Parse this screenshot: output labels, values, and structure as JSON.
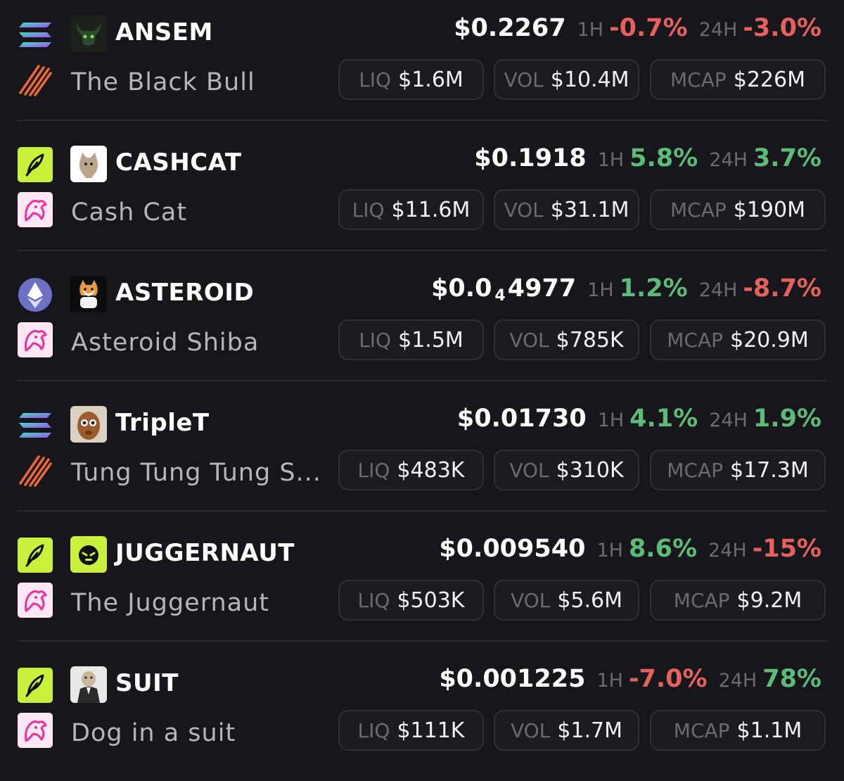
{
  "colors": {
    "background": "#17171b",
    "positive": "#5dbb7a",
    "negative": "#e6605e",
    "muted": "#6a6a72"
  },
  "labels": {
    "h1": "1H",
    "h24": "24H",
    "liq": "LIQ",
    "vol": "VOL",
    "mcap": "MCAP"
  },
  "tokens": [
    {
      "chain_icon": "solana-icon",
      "dex_icon": "dex-stripes-icon",
      "avatar": "bull-avatar",
      "symbol": "ANSEM",
      "name": "The Black Bull",
      "price": "$0.2267",
      "price_prefix": "",
      "price_subscript": "",
      "price_suffix": "",
      "change_1h": "-0.7%",
      "change_1h_dir": "neg",
      "change_24h": "-3.0%",
      "change_24h_dir": "neg",
      "liq": "$1.6M",
      "vol": "$10.4M",
      "mcap": "$226M"
    },
    {
      "chain_icon": "feather-chain-icon",
      "dex_icon": "uniswap-icon",
      "avatar": "cat-avatar",
      "symbol": "CASHCAT",
      "name": "Cash Cat",
      "price": "$0.1918",
      "price_prefix": "",
      "price_subscript": "",
      "price_suffix": "",
      "change_1h": "5.8%",
      "change_1h_dir": "pos",
      "change_24h": "3.7%",
      "change_24h_dir": "pos",
      "liq": "$11.6M",
      "vol": "$31.1M",
      "mcap": "$190M"
    },
    {
      "chain_icon": "ethereum-icon",
      "dex_icon": "uniswap-icon",
      "avatar": "shiba-avatar",
      "symbol": "ASTEROID",
      "name": "Asteroid Shiba",
      "price": "",
      "price_prefix": "$0.0",
      "price_subscript": "4",
      "price_suffix": "4977",
      "change_1h": "1.2%",
      "change_1h_dir": "pos",
      "change_24h": "-8.7%",
      "change_24h_dir": "neg",
      "liq": "$1.5M",
      "vol": "$785K",
      "mcap": "$20.9M"
    },
    {
      "chain_icon": "solana-icon",
      "dex_icon": "dex-stripes-icon",
      "avatar": "face-avatar",
      "symbol": "TripleT",
      "name": "Tung Tung Tung S...",
      "price": "$0.01730",
      "price_prefix": "",
      "price_subscript": "",
      "price_suffix": "",
      "change_1h": "4.1%",
      "change_1h_dir": "pos",
      "change_24h": "1.9%",
      "change_24h_dir": "pos",
      "liq": "$483K",
      "vol": "$310K",
      "mcap": "$17.3M"
    },
    {
      "chain_icon": "feather-chain-icon",
      "dex_icon": "uniswap-icon",
      "avatar": "ghost-avatar",
      "symbol": "JUGGERNAUT",
      "name": "The Juggernaut",
      "price": "$0.009540",
      "price_prefix": "",
      "price_subscript": "",
      "price_suffix": "",
      "change_1h": "8.6%",
      "change_1h_dir": "pos",
      "change_24h": "-15%",
      "change_24h_dir": "neg",
      "liq": "$503K",
      "vol": "$5.6M",
      "mcap": "$9.2M"
    },
    {
      "chain_icon": "feather-chain-icon",
      "dex_icon": "uniswap-icon",
      "avatar": "dog-avatar",
      "symbol": "SUIT",
      "name": "Dog in a suit",
      "price": "$0.001225",
      "price_prefix": "",
      "price_subscript": "",
      "price_suffix": "",
      "change_1h": "-7.0%",
      "change_1h_dir": "neg",
      "change_24h": "78%",
      "change_24h_dir": "pos",
      "liq": "$111K",
      "vol": "$1.7M",
      "mcap": "$1.1M"
    }
  ]
}
